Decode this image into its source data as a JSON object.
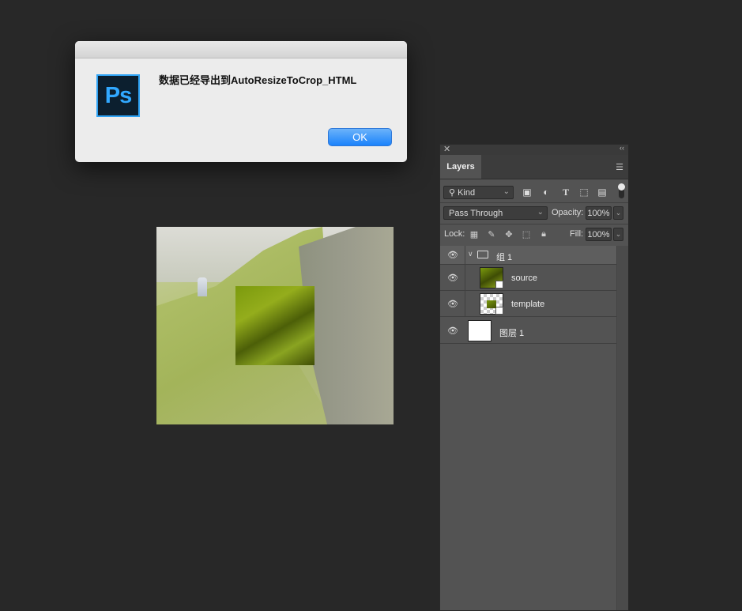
{
  "dialog": {
    "app_icon_label": "Ps",
    "message": "数据已经导出到AutoResizeToCrop_HTML",
    "ok_label": "OK"
  },
  "layers_panel": {
    "tab": "Layers",
    "filter_kind": "Kind",
    "blend_mode": "Pass Through",
    "opacity_label": "Opacity:",
    "opacity_value": "100%",
    "lock_label": "Lock:",
    "fill_label": "Fill:",
    "fill_value": "100%",
    "layers": [
      {
        "name": "组 1",
        "type": "group"
      },
      {
        "name": "source",
        "type": "smart-object"
      },
      {
        "name": "template",
        "type": "smart-object"
      },
      {
        "name": "图层 1",
        "type": "layer"
      }
    ]
  },
  "colors": {
    "app_background": "#282828",
    "panel_background": "#535353",
    "ok_button": "#1a82fb",
    "ps_brand": "#31a8ff"
  }
}
